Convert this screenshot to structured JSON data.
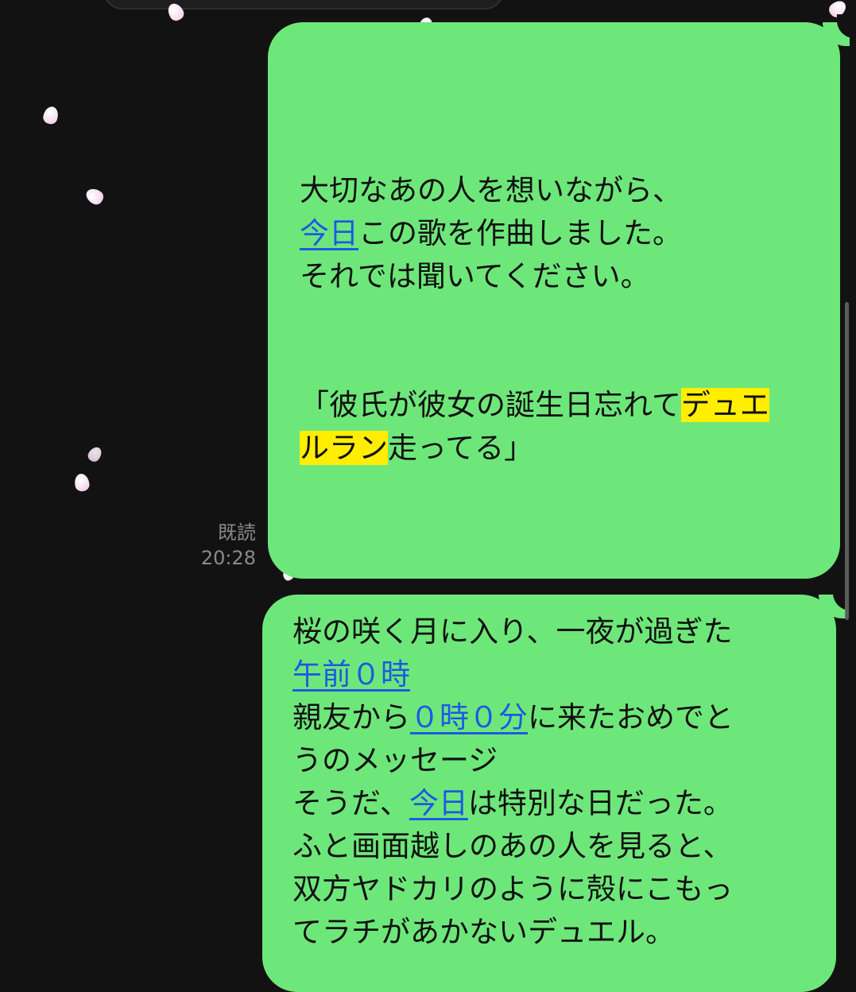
{
  "decorations": {
    "petal_icon": "sakura-petal"
  },
  "messages": [
    {
      "read_label": "既読",
      "time": "20:28",
      "lines": [
        "大切なあの人を想いながら、",
        "今日",
        "この歌を作曲しました。",
        "それでは聞いてください。",
        "「彼氏が彼女の誕生日忘れて",
        "デュエ",
        "ルラン",
        "走ってる」"
      ]
    },
    {
      "lines": [
        "桜の咲く月に入り、一夜が過ぎた",
        "午前０時",
        "親友から",
        "０時０分",
        "に来たおめでと",
        "うのメッセージ",
        "そうだ、",
        "今日",
        "は特別な日だった。",
        "ふと画面越しのあの人を見ると、",
        "双方ヤドカリのように殻にこもっ",
        "てラチがあかないデュエル。"
      ]
    }
  ],
  "colors": {
    "background": "#121212",
    "bubble": "#6ee77a",
    "link": "#1d5ae3",
    "highlight": "#ffee00",
    "meta_text": "#8a8a8a"
  }
}
